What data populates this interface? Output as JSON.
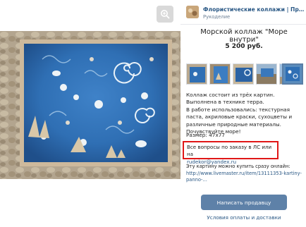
{
  "header": {
    "shop_name": "Флористические коллажи | Предметы интерьера",
    "shop_sub": "Рукоделие"
  },
  "product": {
    "title": "Морской коллаж \"Море внутри\"",
    "price": "5 200 руб."
  },
  "thumbnails": {
    "count": 6,
    "selected_index": 5
  },
  "description": {
    "paragraphs": [
      "Коллаж состоит из трёх картин. Выполнена в технике терра.",
      "В работе использовались: текстурная паста, акриловые краски, сухоцветы и различные природные материалы.",
      "Почувствуйте море!"
    ],
    "size": "Размер: 47х77",
    "contact_text": "Все вопросы по заказу в ЛС или на",
    "contact_email": "rudekor@yandex.ru",
    "buy_text": "Эту картину можно купить сразу онлайн:",
    "buy_link": "http://www.livemaster.ru/item/13111353-kartiny-panno-..."
  },
  "actions": {
    "write_seller": "Написать продавцу",
    "payment_terms": "Условия оплаты и доставки"
  },
  "colors": {
    "accent": "#5e81a8",
    "link": "#2a5885",
    "highlight": "#e01717"
  },
  "icons": {
    "zoom": "zoom-in-icon"
  }
}
